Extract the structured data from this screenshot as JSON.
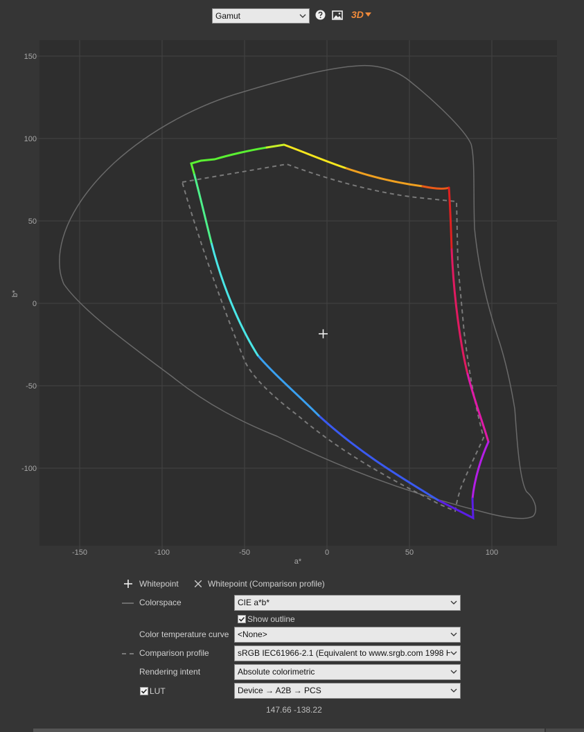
{
  "toolbar": {
    "view_select": "Gamut",
    "help_icon": "help-circle-icon",
    "image_icon": "image-icon",
    "three_d_label": "3D"
  },
  "plot": {
    "x_axis_label": "a*",
    "y_axis_label": "b*",
    "x_ticks": [
      "-150",
      "-100",
      "-50",
      "0",
      "50",
      "100"
    ],
    "y_ticks": [
      "150",
      "100",
      "50",
      "0",
      "-50",
      "-100"
    ]
  },
  "legend": {
    "whitepoint": "Whitepoint",
    "whitepoint_comparison": "Whitepoint (Comparison profile)"
  },
  "controls": {
    "colorspace_label": "Colorspace",
    "colorspace_value": "CIE a*b*",
    "show_outline_label": "Show outline",
    "show_outline_checked": true,
    "color_temp_label": "Color temperature curve",
    "color_temp_value": "<None>",
    "comparison_label": "Comparison profile",
    "comparison_value": "sRGB IEC61966-2.1 (Equivalent to www.srgb.com 1998 HP",
    "intent_label": "Rendering intent",
    "intent_value": "Absolute colorimetric",
    "lut_label": "LUT",
    "lut_checked": true,
    "lut_value": "Device → A2B → PCS"
  },
  "status": {
    "cursor_coords": "147.66 -138.22"
  },
  "colors": {
    "background": "#353535",
    "plot_background": "#2e2e2e",
    "accent_3d": "#f08a3a"
  }
}
